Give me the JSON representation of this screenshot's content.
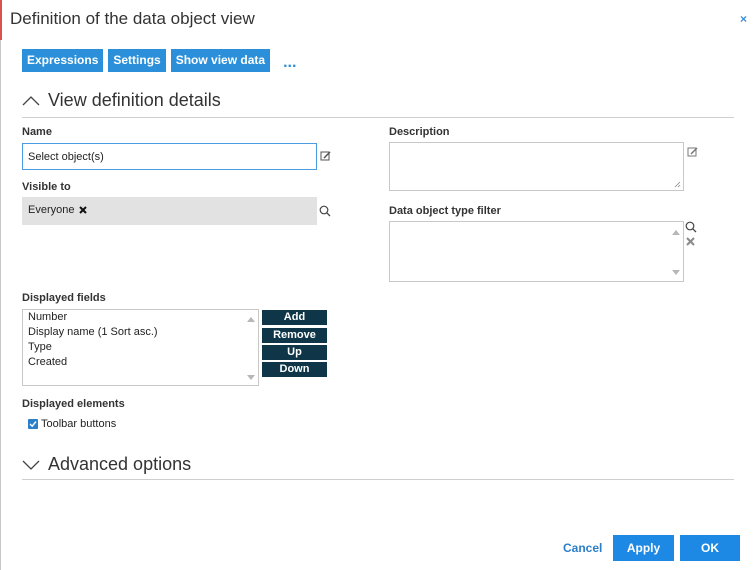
{
  "dialog": {
    "title": "Definition of the data object view",
    "close_glyph": "×"
  },
  "toolbar": {
    "buttons": [
      "Expressions",
      "Settings",
      "Show view data"
    ],
    "more": "..."
  },
  "sections": {
    "view_definition": "View definition details",
    "advanced": "Advanced options"
  },
  "form": {
    "name_label": "Name",
    "name_value": "Select object(s)",
    "visible_label": "Visible to",
    "visible_tag": "Everyone",
    "description_label": "Description",
    "type_filter_label": "Data object type filter",
    "displayed_fields_label": "Displayed fields",
    "displayed_fields": [
      "Number",
      "Display name (1 Sort asc.)",
      "Type",
      "Created"
    ],
    "field_buttons": [
      "Add",
      "Remove",
      "Up",
      "Down"
    ],
    "displayed_elements_label": "Displayed elements",
    "toolbar_buttons_label": "Toolbar buttons",
    "toolbar_buttons_checked": true
  },
  "footer": {
    "cancel": "Cancel",
    "apply": "Apply",
    "ok": "OK"
  },
  "colors": {
    "accent": "#2b90d9",
    "dark_button": "#0e3648",
    "tag_bg": "#e2e2e2"
  },
  "icons": [
    "edit-icon",
    "search-icon",
    "remove-icon",
    "chevron-up-icon",
    "chevron-down-icon",
    "close-icon"
  ]
}
